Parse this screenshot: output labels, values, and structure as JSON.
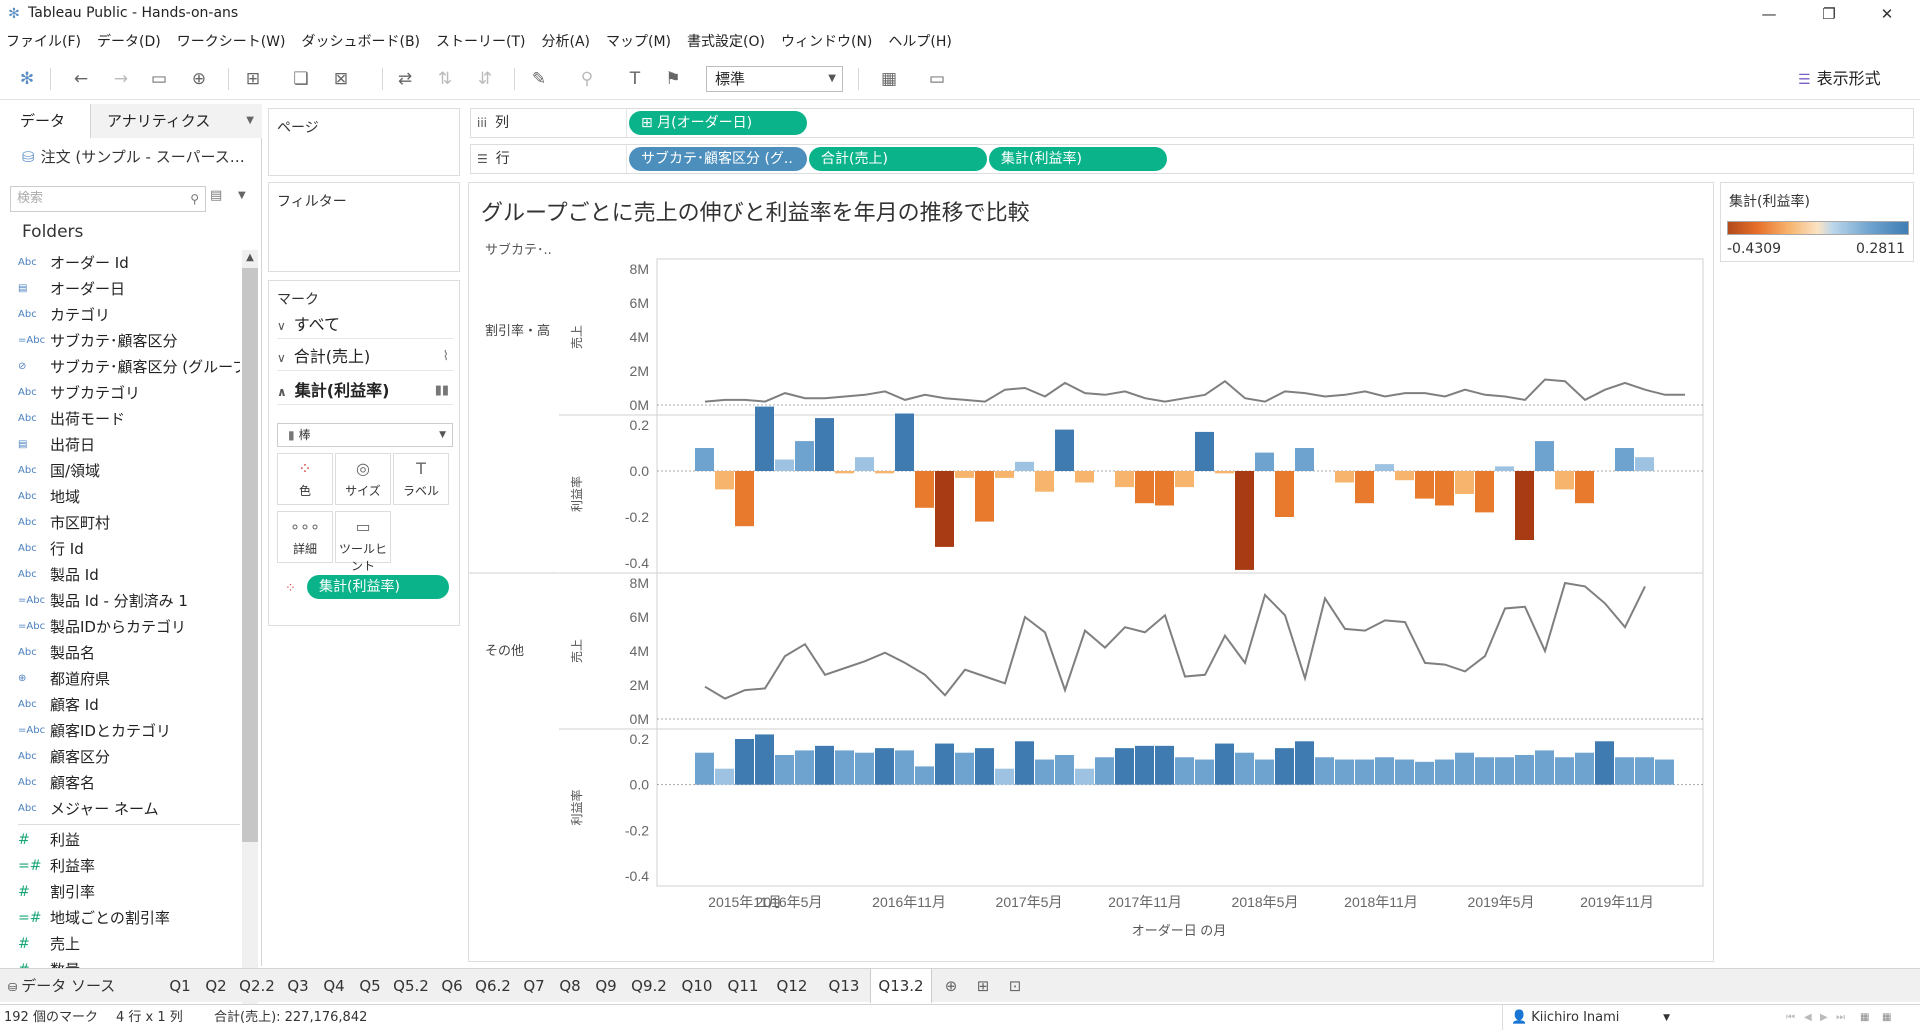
{
  "window": {
    "title": "Tableau Public - Hands-on-ans",
    "minimize": "—",
    "restore": "❐",
    "close": "✕"
  },
  "menu": [
    "ファイル(F)",
    "データ(D)",
    "ワークシート(W)",
    "ダッシュボード(B)",
    "ストーリー(T)",
    "分析(A)",
    "マップ(M)",
    "書式設定(O)",
    "ウィンドウ(N)",
    "ヘルプ(H)"
  ],
  "toolbar": {
    "fit_select": "標準",
    "show_me": "表示形式"
  },
  "data_pane": {
    "tab_data": "データ",
    "tab_analytics": "アナリティクス",
    "datasource": "注文 (サンプル - スーパース…",
    "search_placeholder": "検索",
    "folders_label": "Folders",
    "dimensions": [
      {
        "type": "Abc",
        "name": "オーダー Id"
      },
      {
        "type": "date",
        "name": "オーダー日"
      },
      {
        "type": "Abc",
        "name": "カテゴリ"
      },
      {
        "type": "=Abc",
        "name": "サブカテ･顧客区分"
      },
      {
        "type": "group",
        "name": "サブカテ･顧客区分 (グループ)"
      },
      {
        "type": "Abc",
        "name": "サブカテゴリ"
      },
      {
        "type": "Abc",
        "name": "出荷モード"
      },
      {
        "type": "date",
        "name": "出荷日"
      },
      {
        "type": "Abc",
        "name": "国/領域"
      },
      {
        "type": "Abc",
        "name": "地域"
      },
      {
        "type": "Abc",
        "name": "市区町村"
      },
      {
        "type": "Abc",
        "name": "行 Id"
      },
      {
        "type": "Abc",
        "name": "製品 Id"
      },
      {
        "type": "=Abc",
        "name": "製品 Id - 分割済み 1"
      },
      {
        "type": "=Abc",
        "name": "製品IDからカテゴリ"
      },
      {
        "type": "Abc",
        "name": "製品名"
      },
      {
        "type": "geo",
        "name": "都道府県"
      },
      {
        "type": "Abc",
        "name": "顧客 Id"
      },
      {
        "type": "=Abc",
        "name": "顧客IDとカテゴリ"
      },
      {
        "type": "Abc",
        "name": "顧客区分"
      },
      {
        "type": "Abc",
        "name": "顧客名"
      },
      {
        "type": "Abc",
        "name": "メジャー ネーム"
      }
    ],
    "measures": [
      {
        "type": "#",
        "name": "利益"
      },
      {
        "type": "=#",
        "name": "利益率"
      },
      {
        "type": "#",
        "name": "割引率"
      },
      {
        "type": "=#",
        "name": "地域ごとの割引率"
      },
      {
        "type": "#",
        "name": "売上"
      },
      {
        "type": "#",
        "name": "数量"
      }
    ]
  },
  "cards": {
    "pages": "ページ",
    "filters": "フィルター",
    "marks": "マーク",
    "marks_all": "すべて",
    "marks_sales": "合計(売上)",
    "marks_profit": "集計(利益率)",
    "mark_type": "棒",
    "btn_color": "色",
    "btn_size": "サイズ",
    "btn_label": "ラベル",
    "btn_detail": "詳細",
    "btn_tooltip": "ツールヒント",
    "color_pill": "集計(利益率)"
  },
  "shelves": {
    "columns_label": "列",
    "rows_label": "行",
    "columns_pill": "⊞ 月(オーダー日)",
    "rows_pills": [
      "サブカテ･顧客区分 (グ..",
      "合計(売上)",
      "集計(利益率)"
    ]
  },
  "view": {
    "title": "グループごとに売上の伸びと利益率を年月の推移で比較",
    "row_header": "サブカテ･..",
    "groups": [
      "割引率・高",
      "その他"
    ],
    "measure_sales": "売上",
    "measure_profit": "利益率",
    "x_axis_title": "オーダー日 の月"
  },
  "legend": {
    "title": "集計(利益率)",
    "min": "-0.4309",
    "max": "0.2811",
    "colors": {
      "neg_dark": "#a83a14",
      "neg_mid": "#e87a2e",
      "neg_light": "#f7b46c",
      "pos_light": "#9ec3e2",
      "pos_mid": "#6ea2cf",
      "pos_dark": "#3f7ab0"
    }
  },
  "chart_data": {
    "type": "line",
    "x_tick_labels": [
      "2015年11月",
      "2016年5月",
      "2016年11月",
      "2017年5月",
      "2017年11月",
      "2018年5月",
      "2018年11月",
      "2019年5月",
      "2019年11月"
    ],
    "x_start": "2015-11",
    "x_months": 50,
    "sales_axis": {
      "ylim": [
        0,
        8
      ],
      "ticks": [
        "0M",
        "2M",
        "4M",
        "6M",
        "8M"
      ]
    },
    "profit_axis": {
      "ylim": [
        -0.4,
        0.2
      ],
      "ticks": [
        "0.2",
        "0.0",
        "-0.2",
        "-0.4"
      ]
    },
    "panels": [
      {
        "group": "割引率・高",
        "sales_millions": [
          0.2,
          0.3,
          0.3,
          0.2,
          0.7,
          0.4,
          0.4,
          0.5,
          0.6,
          0.8,
          0.3,
          0.6,
          0.4,
          0.3,
          0.2,
          0.9,
          1.0,
          0.5,
          1.3,
          0.7,
          0.6,
          0.8,
          0.4,
          0.2,
          0.4,
          0.6,
          1.4,
          0.4,
          0.2,
          0.8,
          0.7,
          0.5,
          0.6,
          0.8,
          0.5,
          0.7,
          0.7,
          0.5,
          0.9,
          0.6,
          0.5,
          0.3,
          1.5,
          1.4,
          0.3,
          0.9,
          1.3,
          0.9,
          0.6,
          0.6
        ],
        "profit_ratio": [
          0.1,
          -0.08,
          -0.24,
          0.28,
          0.05,
          0.13,
          0.23,
          -0.01,
          0.06,
          -0.01,
          0.25,
          -0.16,
          -0.33,
          -0.03,
          -0.22,
          -0.03,
          0.04,
          -0.09,
          0.18,
          -0.05,
          0.0,
          -0.07,
          -0.14,
          -0.15,
          -0.07,
          0.17,
          -0.01,
          -0.43,
          0.08,
          -0.2,
          0.1,
          0.0,
          -0.05,
          -0.14,
          0.03,
          -0.04,
          -0.12,
          -0.15,
          -0.1,
          -0.18,
          0.02,
          -0.3,
          0.13,
          -0.08,
          -0.14,
          0.0,
          0.1,
          0.06,
          0.0,
          0.0
        ]
      },
      {
        "group": "その他",
        "sales_millions": [
          1.9,
          1.2,
          1.7,
          1.8,
          3.7,
          4.4,
          2.6,
          3.0,
          3.4,
          3.9,
          3.3,
          2.6,
          1.4,
          2.9,
          2.5,
          2.1,
          6.0,
          5.1,
          1.7,
          5.2,
          4.2,
          5.4,
          5.1,
          6.1,
          2.5,
          2.6,
          4.9,
          3.3,
          7.3,
          6.1,
          2.4,
          7.1,
          5.3,
          5.2,
          5.8,
          5.7,
          3.3,
          3.2,
          2.8,
          3.7,
          6.5,
          6.6,
          4.0,
          8.0,
          7.8,
          6.8,
          5.4,
          7.8,
          0,
          0
        ],
        "profit_ratio": [
          0.14,
          0.07,
          0.2,
          0.22,
          0.13,
          0.15,
          0.17,
          0.15,
          0.14,
          0.16,
          0.15,
          0.08,
          0.18,
          0.14,
          0.16,
          0.07,
          0.19,
          0.11,
          0.13,
          0.07,
          0.12,
          0.16,
          0.17,
          0.17,
          0.12,
          0.11,
          0.18,
          0.14,
          0.11,
          0.16,
          0.19,
          0.12,
          0.11,
          0.11,
          0.12,
          0.11,
          0.1,
          0.11,
          0.14,
          0.12,
          0.12,
          0.13,
          0.15,
          0.12,
          0.14,
          0.19,
          0.12,
          0.12,
          0.11,
          0.0
        ]
      }
    ]
  },
  "sheet_tabs": {
    "datasource": "データ ソース",
    "tabs": [
      "Q1",
      "Q2",
      "Q2.2",
      "Q3",
      "Q4",
      "Q5",
      "Q5.2",
      "Q6",
      "Q6.2",
      "Q7",
      "Q8",
      "Q9",
      "Q9.2",
      "Q10",
      "Q11",
      "Q12",
      "Q13",
      "Q13.2"
    ],
    "active": "Q13.2"
  },
  "status": {
    "marks": "192 個のマーク",
    "dims": "4 行 x 1 列",
    "sum": "合計(売上): 227,176,842",
    "user": "Kiichiro Inami"
  }
}
